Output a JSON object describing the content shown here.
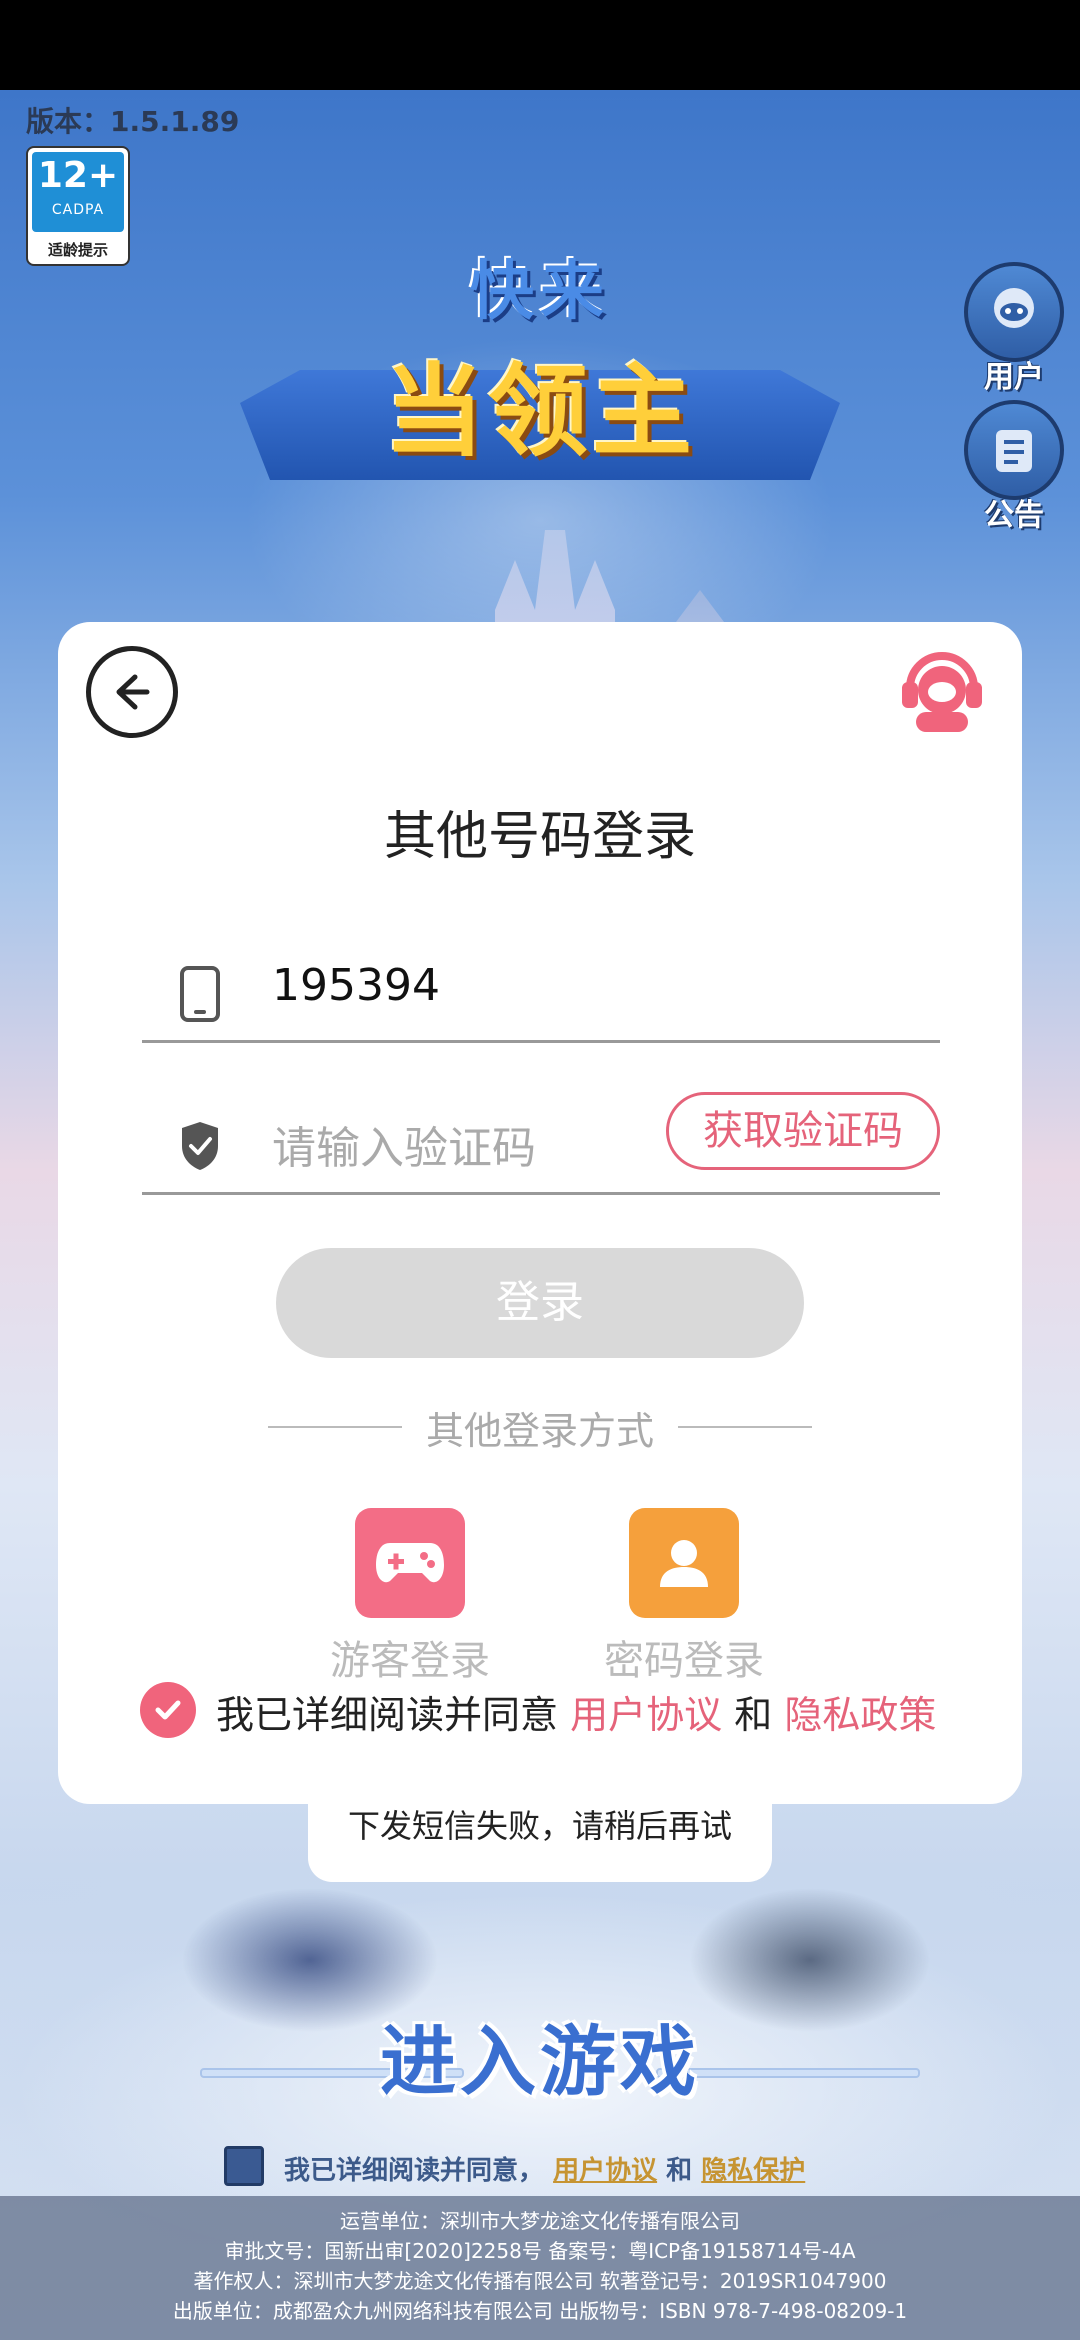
{
  "version_label": "版本：1.5.1.89",
  "age_rating": {
    "value": "12+",
    "org": "CADPA",
    "tip": "适龄提示"
  },
  "game_logo": {
    "line1": "快来",
    "line2": "当领主"
  },
  "side_buttons": {
    "user": "用户",
    "notice": "公告"
  },
  "login_panel": {
    "title": "其他号码登录",
    "phone_value": "195394",
    "code_placeholder": "请输入验证码",
    "get_code_label": "获取验证码",
    "login_label": "登录",
    "other_methods_label": "其他登录方式",
    "guest_login_label": "游客登录",
    "password_login_label": "密码登录",
    "agree_prefix": "我已详细阅读并同意",
    "user_agreement": "用户协议",
    "and": "和",
    "privacy_policy": "隐私政策"
  },
  "toast": "下发短信失败，请稍后再试",
  "enter_game": "进入游戏",
  "bottom_agree": {
    "prefix": "我已详细阅读并同意，",
    "user_agreement": "用户协议",
    "and": "和",
    "privacy": "隐私保护"
  },
  "footer": [
    "运营单位：深圳市大梦龙途文化传播有限公司",
    "审批文号：国新出审[2020]2258号  备案号：粤ICP备19158714号-4A",
    "著作权人：深圳市大梦龙途文化传播有限公司  软著登记号：2019SR1047900",
    "出版单位：成都盈众九州网络科技有限公司  出版物号：ISBN 978-7-498-08209-1"
  ],
  "colors": {
    "accent_pink": "#e5637a",
    "guest_tile": "#f36d86",
    "password_tile": "#f5a03c",
    "login_disabled": "#d9d9d9"
  },
  "icons": [
    "back-arrow-icon",
    "customer-service-icon",
    "phone-icon",
    "shield-check-icon",
    "gamepad-icon",
    "user-icon",
    "checkmark-icon",
    "user-avatar-icon",
    "notice-board-icon"
  ]
}
